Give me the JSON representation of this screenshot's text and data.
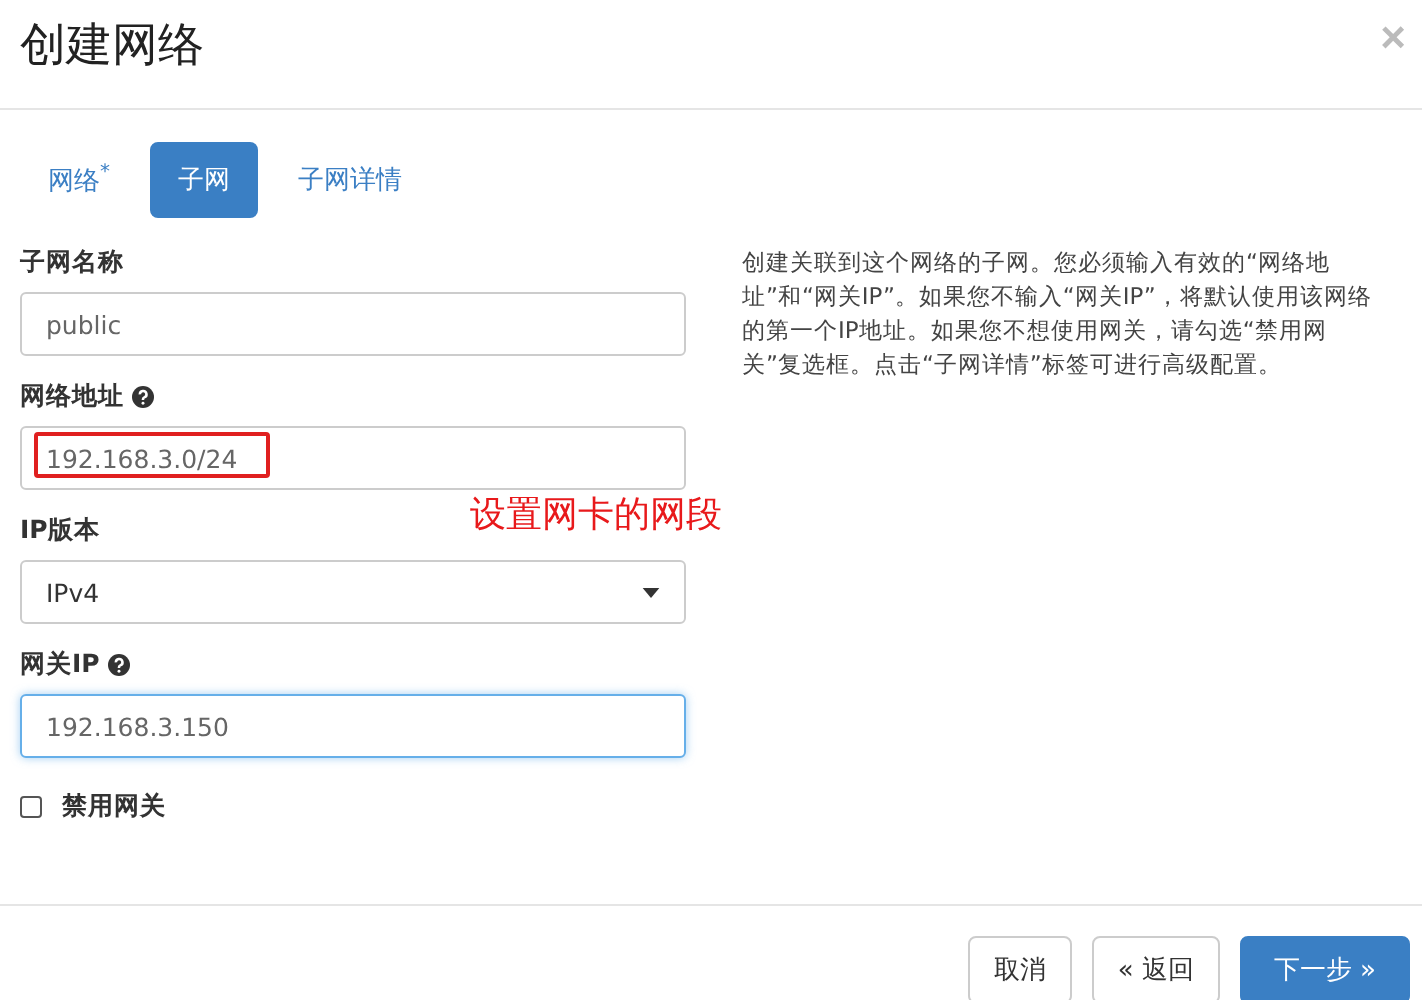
{
  "window": {
    "title": "创建网络",
    "close": "×"
  },
  "tabs": [
    {
      "label": "网络",
      "mark": "*",
      "selected": false
    },
    {
      "label": "子网",
      "selected": true
    },
    {
      "label": "子网详情",
      "selected": false
    }
  ],
  "fields": [
    {
      "kind": "text",
      "label": "子网名称",
      "help": false,
      "placeholder": "public",
      "focused": false,
      "highlighted": false
    },
    {
      "kind": "text",
      "label": "网络地址",
      "help": true,
      "placeholder": "192.168.3.0/24",
      "focused": false,
      "highlighted": true
    },
    {
      "kind": "select",
      "label": "IP版本",
      "help": false,
      "value": "IPv4",
      "focused": false,
      "highlighted": false
    },
    {
      "kind": "text",
      "label": "网关IP",
      "help": true,
      "placeholder": "192.168.3.150",
      "focused": true,
      "highlighted": false
    }
  ],
  "checkbox": {
    "label": "禁用网关",
    "checked": false
  },
  "description": "创建关联到这个网络的子网。您必须输入有效的“网络地址”和“网关IP”。如果您不输入“网关IP”，将默认使用该网络的第一个IP地址。如果您不想使用网关，请勾选“禁用网关”复选框。点击“子网详情”标签可进行高级配置。",
  "annotation": "设置网卡的网段",
  "buttons": [
    {
      "label": "取消",
      "kind": "default"
    },
    {
      "label": "« 返回",
      "kind": "default"
    },
    {
      "label": "下一步 »",
      "kind": "primary"
    }
  ]
}
